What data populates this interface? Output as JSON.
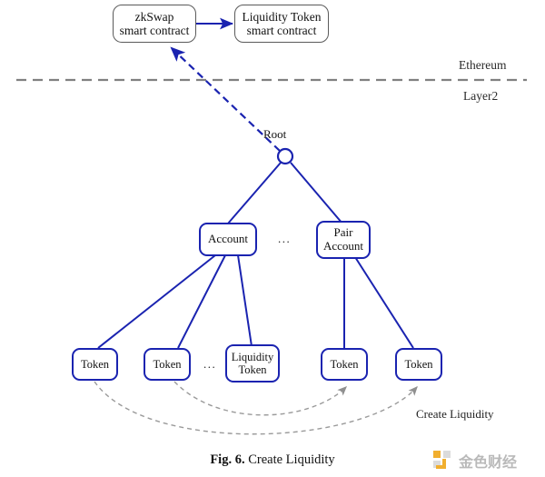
{
  "figure": {
    "caption_number": "Fig. 6.",
    "caption_title": "Create Liquidity"
  },
  "layers": {
    "above_label": "Ethereum",
    "below_label": "Layer2",
    "divider_color": "#808080"
  },
  "contracts": [
    {
      "id": "zkswap",
      "line1": "zkSwap",
      "line2": "smart contract"
    },
    {
      "id": "liquidity-token",
      "line1": "Liquidity Token",
      "line2": "smart contract"
    }
  ],
  "tree": {
    "root_label": "Root",
    "root_color": "#1a23b0",
    "level1": [
      {
        "id": "account",
        "line1": "Account",
        "line2": ""
      },
      {
        "id": "pair-account",
        "line1": "Pair",
        "line2": "Account"
      }
    ],
    "level1_ellipsis": "...",
    "leaves": [
      {
        "id": "token-1",
        "line1": "Token",
        "line2": ""
      },
      {
        "id": "token-2",
        "line1": "Token",
        "line2": ""
      },
      {
        "id": "liquidity-token-leaf",
        "line1": "Liquidity",
        "line2": "Token"
      },
      {
        "id": "token-3",
        "line1": "Token",
        "line2": ""
      },
      {
        "id": "token-4",
        "line1": "Token",
        "line2": ""
      }
    ],
    "leaves_ellipsis": "..."
  },
  "annotations": {
    "create_liquidity": "Create Liquidity"
  },
  "watermark": {
    "text": "金色财经",
    "icon_color": "#f0a91e"
  },
  "colors": {
    "node_blue": "#1a23b0",
    "dashed_gray": "#808080",
    "curve_gray": "#9a9a9a"
  }
}
